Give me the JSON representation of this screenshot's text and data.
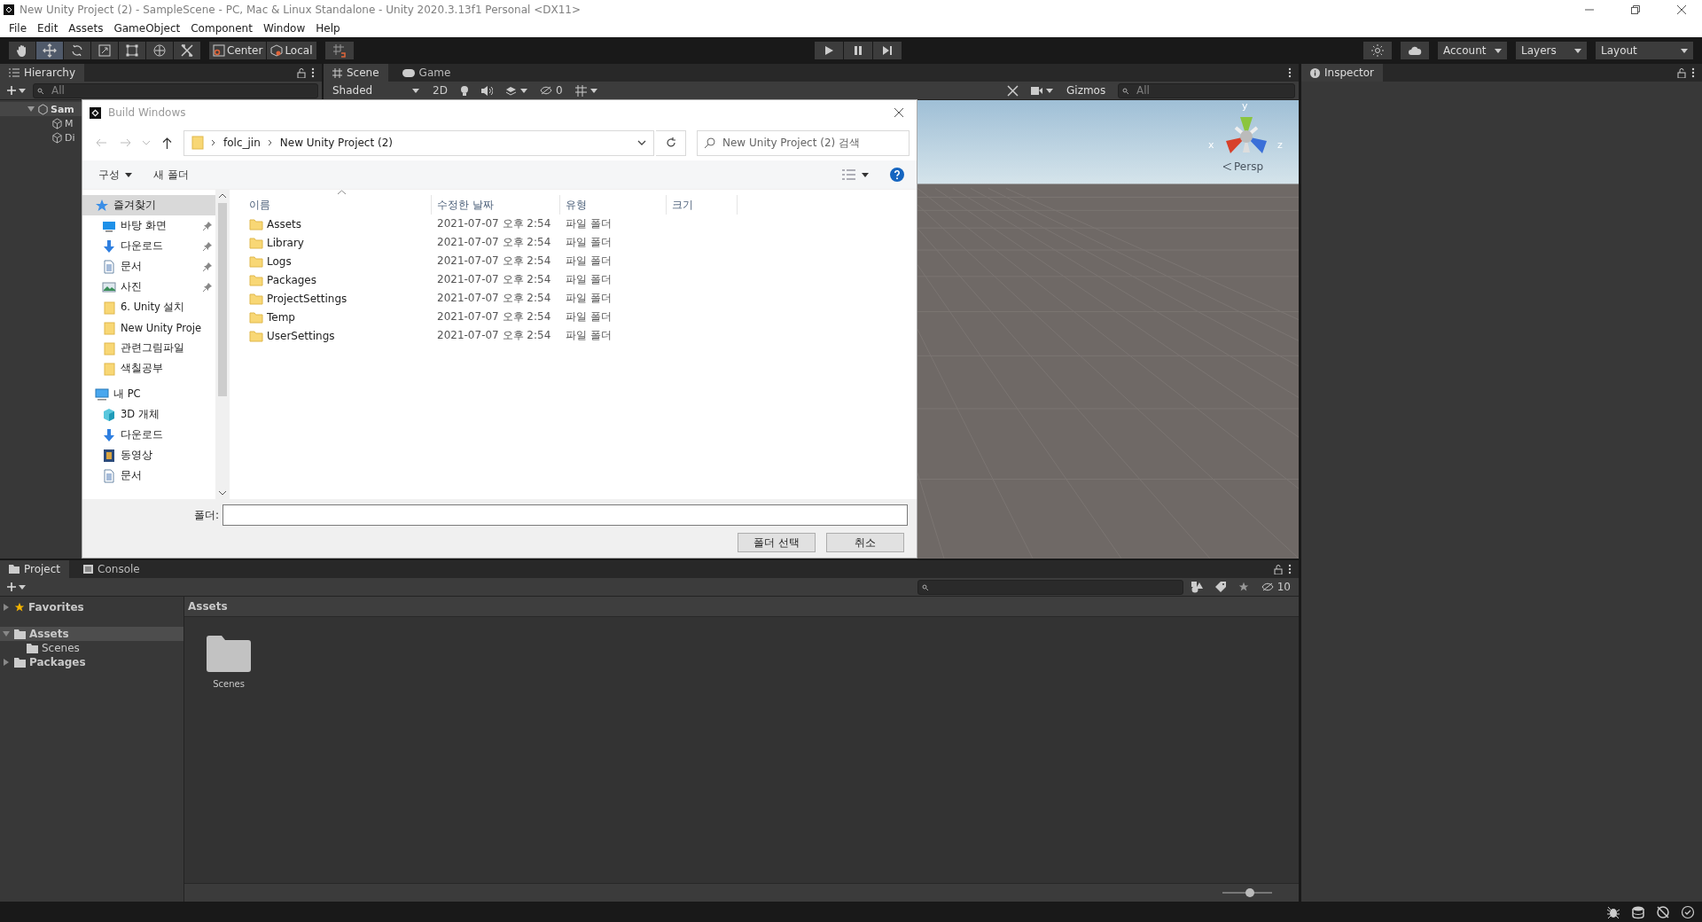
{
  "window": {
    "title": "New Unity Project (2) - SampleScene - PC, Mac & Linux Standalone - Unity 2020.3.13f1 Personal <DX11>"
  },
  "menu": [
    "File",
    "Edit",
    "Assets",
    "GameObject",
    "Component",
    "Window",
    "Help"
  ],
  "toolbar": {
    "tools": [
      {
        "kind": "hand",
        "selected": false
      },
      {
        "kind": "move",
        "selected": true
      },
      {
        "kind": "rotate",
        "selected": false
      },
      {
        "kind": "scale",
        "selected": false
      },
      {
        "kind": "rect",
        "selected": false
      },
      {
        "kind": "transform",
        "selected": false
      },
      {
        "kind": "custom",
        "selected": false
      }
    ],
    "pivot": "Center",
    "space": "Local",
    "account": "Account",
    "layers": "Layers",
    "layout": "Layout"
  },
  "hierarchy": {
    "tab": "Hierarchy",
    "search": {
      "placeholder": "All"
    },
    "items": [
      {
        "label": "Sam",
        "expanded": true,
        "children": [
          {
            "label": "M"
          },
          {
            "label": "Di"
          }
        ]
      }
    ]
  },
  "scene": {
    "tabs": [
      {
        "label": "Scene",
        "kind": "scene",
        "selected": true
      },
      {
        "label": "Game",
        "kind": "game",
        "selected": false
      }
    ],
    "shading": "Shaded",
    "mode_2d": "2D",
    "hidden_count": "0",
    "gizmos": "Gizmos",
    "search": {
      "placeholder": "All"
    },
    "axes": [
      "x",
      "y",
      "z"
    ],
    "projection": "Persp"
  },
  "inspector": {
    "tab": "Inspector"
  },
  "dialog": {
    "title": "Build Windows",
    "path": [
      "folc_jin",
      "New Unity Project (2)"
    ],
    "search": {
      "placeholder": "New Unity Project (2) 검색"
    },
    "organize": "구성",
    "new_folder": "새 폴더",
    "nav": [
      {
        "label": "즐겨찾기",
        "kind": "star",
        "selected": true,
        "children": [
          {
            "label": "바탕 화면",
            "kind": "desktop",
            "pinned": true,
            "selected": false
          },
          {
            "label": "다운로드",
            "kind": "download",
            "pinned": true,
            "selected": false
          },
          {
            "label": "문서",
            "kind": "document",
            "pinned": true,
            "selected": false
          },
          {
            "label": "사진",
            "kind": "picture",
            "pinned": true,
            "selected": false
          },
          {
            "label": "6. Unity 설치",
            "kind": "folder",
            "pinned": false,
            "selected": false
          },
          {
            "label": "New Unity Proje",
            "kind": "folder",
            "pinned": false,
            "selected": false
          },
          {
            "label": "관련그림파일",
            "kind": "folder",
            "pinned": false,
            "selected": false
          },
          {
            "label": "색칠공부",
            "kind": "folder",
            "pinned": false,
            "selected": false
          }
        ]
      },
      {
        "label": "내 PC",
        "kind": "pc",
        "selected": false,
        "children": [
          {
            "label": "3D 개체",
            "kind": "cube",
            "pinned": false,
            "selected": false
          },
          {
            "label": "다운로드",
            "kind": "download",
            "pinned": false,
            "selected": false
          },
          {
            "label": "동영상",
            "kind": "video",
            "pinned": false,
            "selected": false
          },
          {
            "label": "문서",
            "kind": "document",
            "pinned": false,
            "selected": false
          }
        ]
      }
    ],
    "columns": [
      "이름",
      "수정한 날짜",
      "유형",
      "크기"
    ],
    "rows": [
      {
        "name": "Assets",
        "modified": "2021-07-07 오후 2:54",
        "type": "파일 폴더"
      },
      {
        "name": "Library",
        "modified": "2021-07-07 오후 2:54",
        "type": "파일 폴더"
      },
      {
        "name": "Logs",
        "modified": "2021-07-07 오후 2:54",
        "type": "파일 폴더"
      },
      {
        "name": "Packages",
        "modified": "2021-07-07 오후 2:54",
        "type": "파일 폴더"
      },
      {
        "name": "ProjectSettings",
        "modified": "2021-07-07 오후 2:54",
        "type": "파일 폴더"
      },
      {
        "name": "Temp",
        "modified": "2021-07-07 오후 2:54",
        "type": "파일 폴더"
      },
      {
        "name": "UserSettings",
        "modified": "2021-07-07 오후 2:54",
        "type": "파일 폴더"
      }
    ],
    "folder_label": "폴더:",
    "buttons": [
      "폴더 선택",
      "취소"
    ]
  },
  "project": {
    "tabs": [
      {
        "label": "Project",
        "kind": "project",
        "selected": true
      },
      {
        "label": "Console",
        "kind": "console",
        "selected": false
      }
    ],
    "tree": [
      {
        "label": "Favorites",
        "kind": "favorites",
        "expanded": false,
        "selected": false
      },
      {
        "label": "Assets",
        "kind": "folder",
        "expanded": true,
        "selected": true,
        "children": [
          {
            "label": "Scenes",
            "selected": false
          }
        ]
      },
      {
        "label": "Packages",
        "kind": "folder",
        "expanded": false,
        "selected": false
      }
    ],
    "breadcrumb": "Assets",
    "items": [
      {
        "label": "Scenes"
      }
    ],
    "hidden_count": "10",
    "zoom": {
      "level": 0.55
    }
  }
}
